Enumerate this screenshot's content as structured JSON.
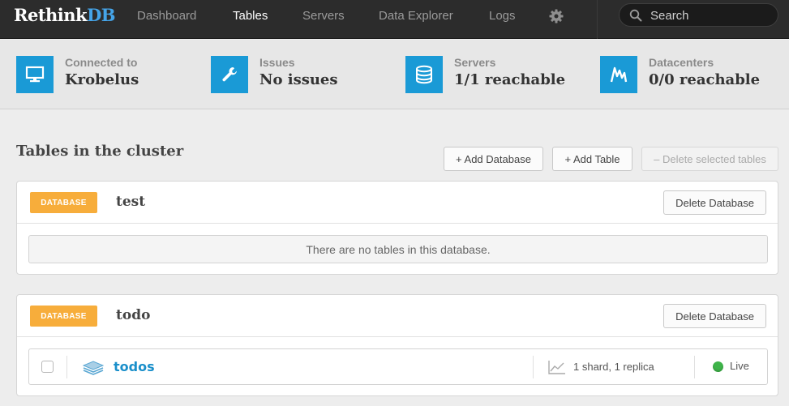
{
  "navbar": {
    "logo_part1": "Rethink",
    "logo_part2": "DB",
    "items": [
      {
        "label": "Dashboard"
      },
      {
        "label": "Tables"
      },
      {
        "label": "Servers"
      },
      {
        "label": "Data Explorer"
      },
      {
        "label": "Logs"
      }
    ],
    "active_item": "Tables",
    "settings_icon": "gear-icon",
    "search_placeholder": "Search"
  },
  "stats": {
    "connected": {
      "label": "Connected to",
      "value": "Krobelus",
      "icon": "monitor-icon"
    },
    "issues": {
      "label": "Issues",
      "value": "No issues",
      "icon": "wrench-icon"
    },
    "servers": {
      "label": "Servers",
      "value": "1/1 reachable",
      "icon": "database-icon"
    },
    "datacenters": {
      "label": "Datacenters",
      "value": "0/0 reachable",
      "icon": "datacenter-icon"
    }
  },
  "main": {
    "title": "Tables in the cluster",
    "add_database": "+ Add Database",
    "add_table": "+ Add Table",
    "delete_selected": "– Delete selected tables"
  },
  "databases": [
    {
      "badge": "DATABASE",
      "name": "test",
      "delete_label": "Delete Database",
      "empty_message": "There are no tables in this database."
    },
    {
      "badge": "DATABASE",
      "name": "todo",
      "delete_label": "Delete Database",
      "tables": [
        {
          "name": "todos",
          "shards": "1 shard, 1 replica",
          "status": "Live"
        }
      ]
    }
  ],
  "colors": {
    "navbar_bg": "#2c2c2c",
    "accent_blue": "#1a9ad6",
    "badge_orange": "#f7ad3b",
    "status_live": "#3fb44a"
  }
}
